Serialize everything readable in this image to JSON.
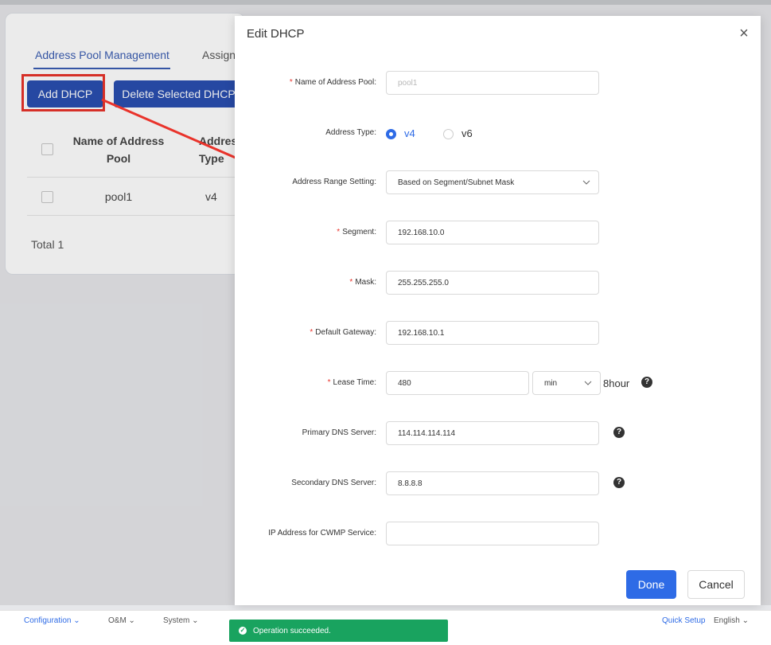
{
  "background": {
    "tabs": [
      "Address Pool Management",
      "Assign"
    ],
    "add_button": "Add DHCP",
    "delete_button": "Delete Selected DHCP",
    "table": {
      "headers": [
        "Name of Address Pool",
        "Address Type"
      ],
      "rows": [
        [
          "pool1",
          "v4"
        ]
      ]
    },
    "total": "Total 1"
  },
  "modal": {
    "title": "Edit DHCP",
    "close_icon": "close-icon",
    "fields": {
      "pool_name": {
        "label": "Name of Address Pool:",
        "placeholder": "pool1",
        "required": true
      },
      "address_type": {
        "label": "Address Type:",
        "options": [
          "v4",
          "v6"
        ],
        "selected": "v4"
      },
      "range_setting": {
        "label": "Address Range Setting:",
        "value": "Based on Segment/Subnet Mask"
      },
      "segment": {
        "label": "Segment:",
        "value": "192.168.10.0",
        "required": true
      },
      "mask": {
        "label": "Mask:",
        "value": "255.255.255.0",
        "required": true
      },
      "gateway": {
        "label": "Default Gateway:",
        "value": "192.168.10.1",
        "required": true
      },
      "lease": {
        "label": "Lease Time:",
        "value": "480",
        "unit": "min",
        "suffix": "8hour",
        "required": true
      },
      "primary_dns": {
        "label": "Primary DNS Server:",
        "value": "114.114.114.114"
      },
      "secondary_dns": {
        "label": "Secondary DNS Server:",
        "value": "8.8.8.8"
      },
      "cwmp": {
        "label": "IP Address for CWMP Service:",
        "value": ""
      }
    },
    "done": "Done",
    "cancel": "Cancel"
  },
  "bottom": {
    "nav": [
      "Configuration",
      "O&M",
      "System"
    ],
    "quick_setup": "Quick Setup",
    "language": "English",
    "toast": "Operation succeeded."
  },
  "colors": {
    "primary": "#2e6be6",
    "annotation": "#e9332b",
    "success": "#19a35f"
  }
}
